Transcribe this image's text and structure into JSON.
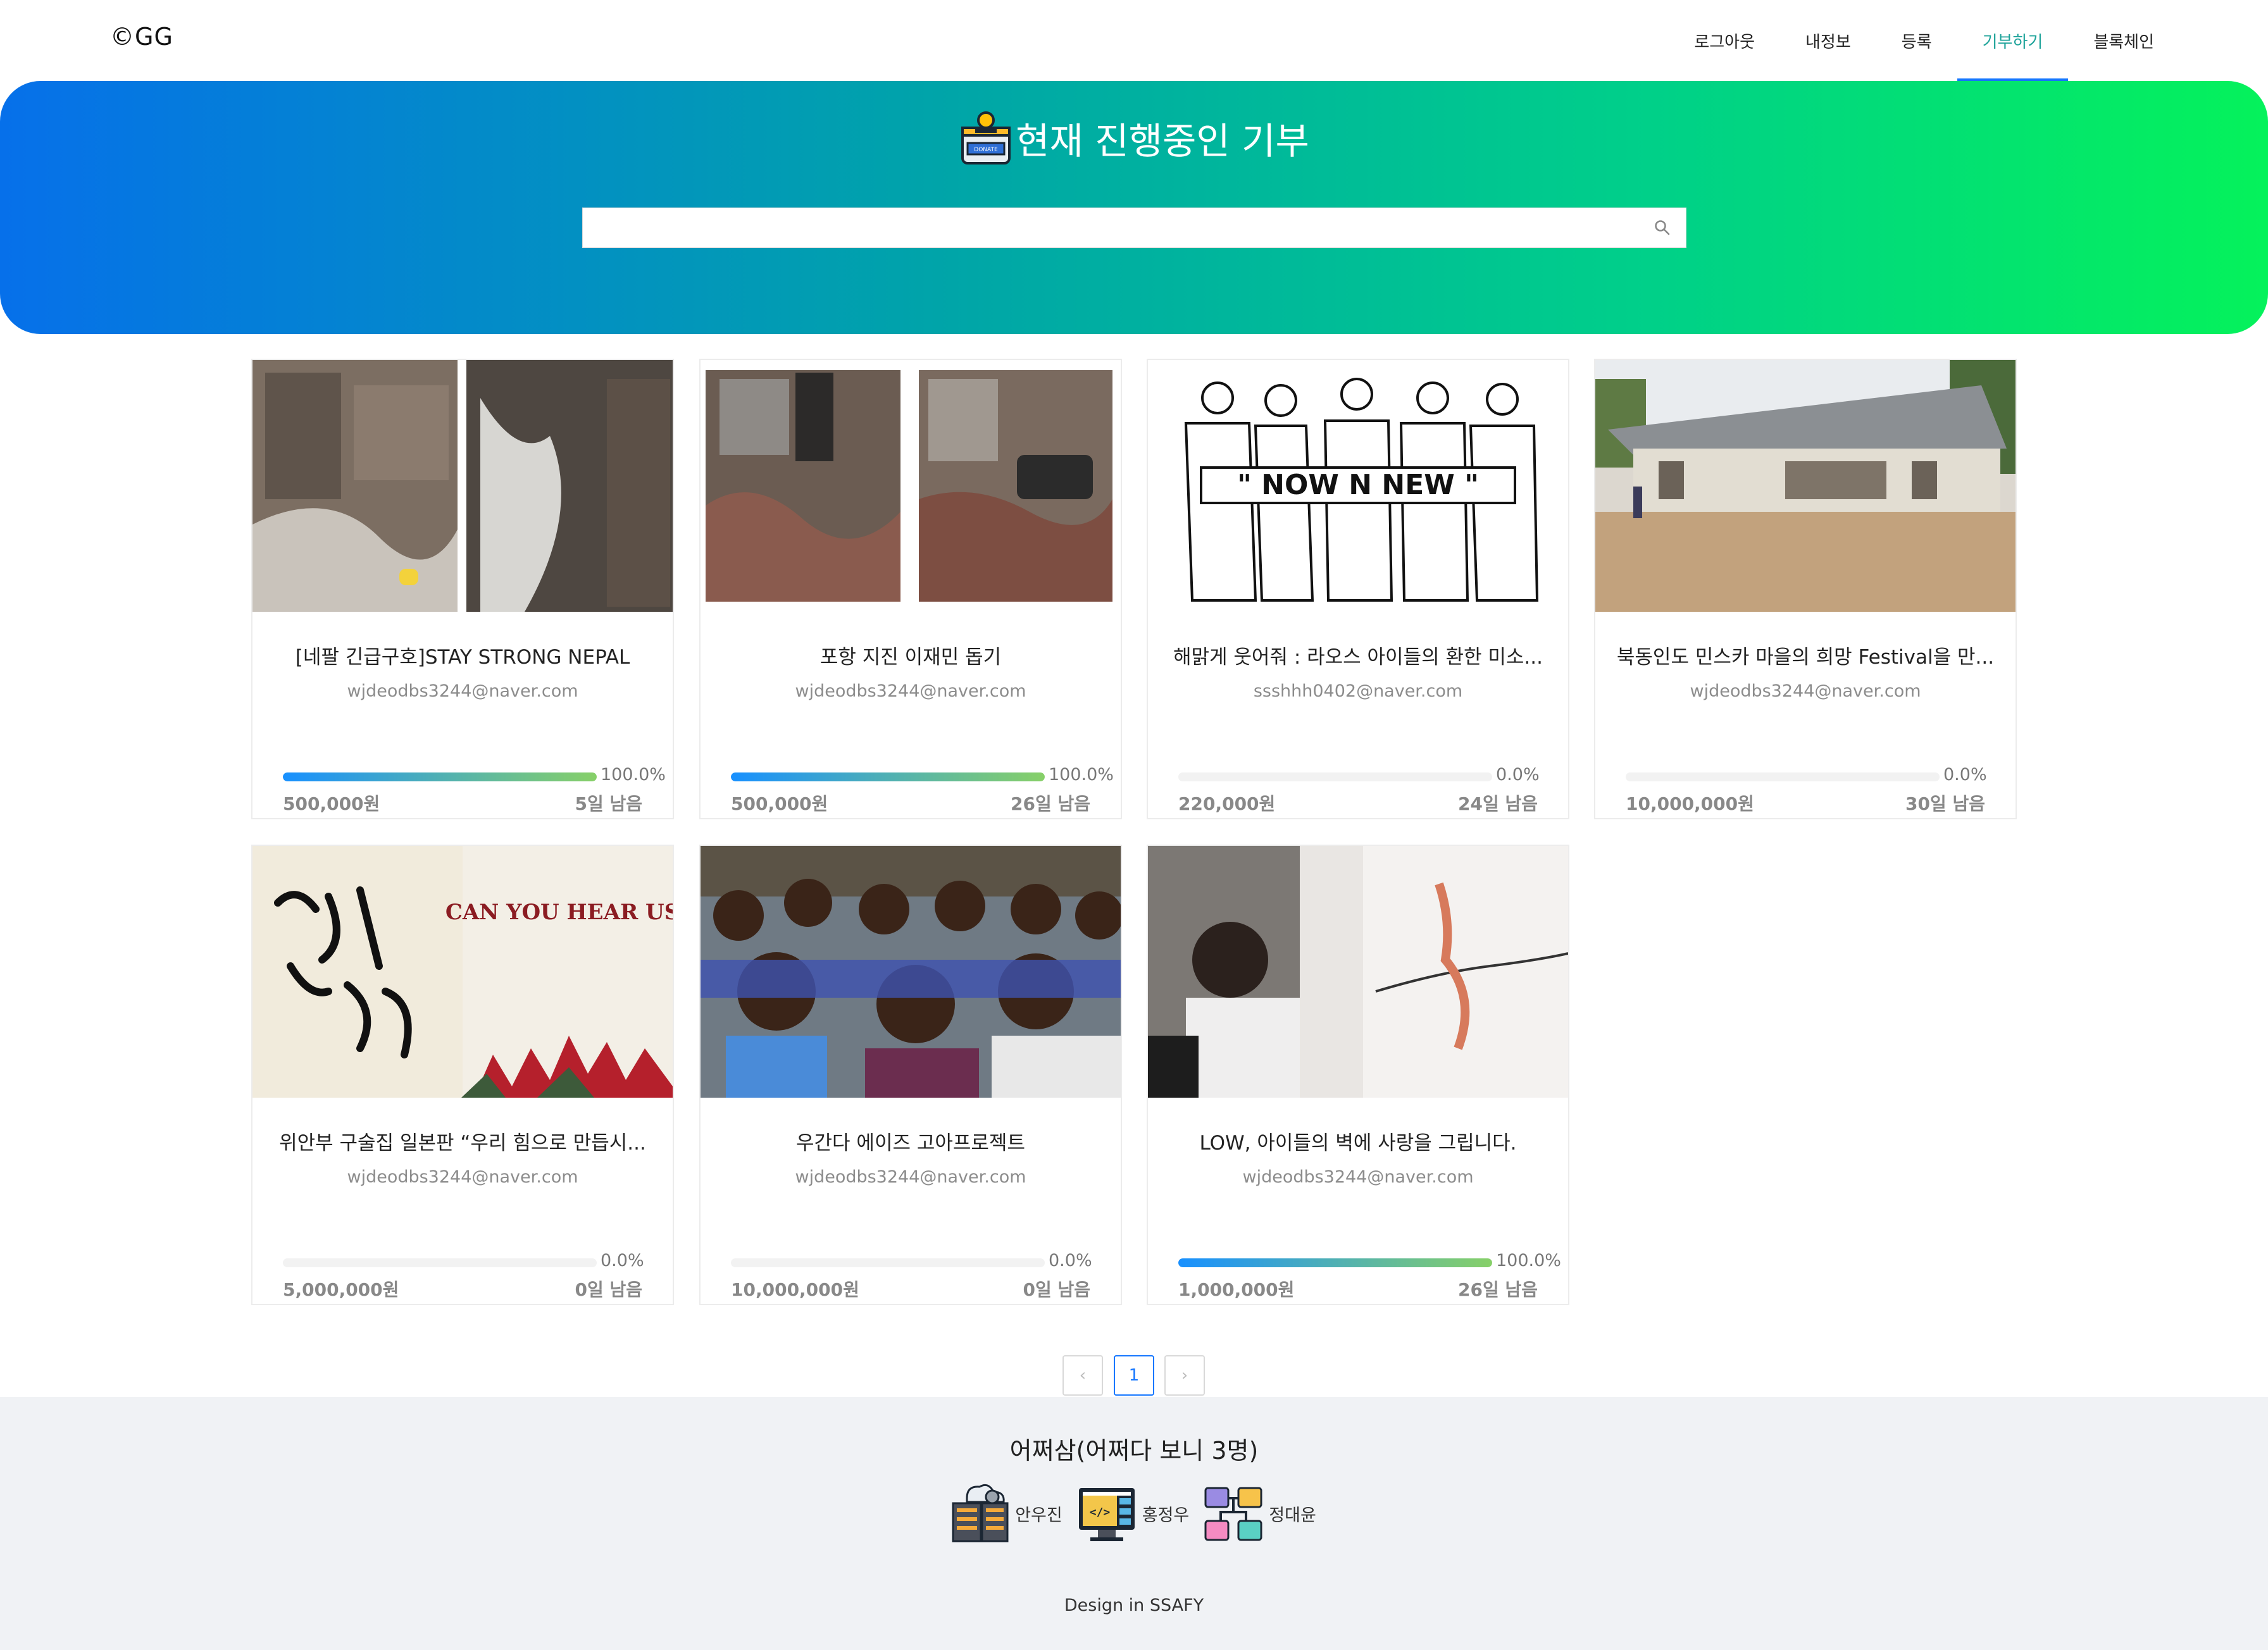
{
  "header": {
    "logo": "©GG",
    "nav": [
      "로그아웃",
      "내정보",
      "등록",
      "기부하기",
      "블록체인"
    ],
    "active_nav": "기부하기"
  },
  "hero": {
    "title": "현재 진행중인 기부",
    "icon": "donate-box-icon",
    "badge_text": "DONATE",
    "search": {
      "value": "",
      "placeholder": ""
    }
  },
  "campaigns": [
    {
      "title": "[네팔 긴급구호]STAY STRONG NEPAL",
      "author": "wjdeodbs3244@naver.com",
      "progress": "100.0%",
      "progress_value": 100,
      "amount": "500,000원",
      "days": "5일 남음"
    },
    {
      "title": "포항 지진 이재민 돕기",
      "author": "wjdeodbs3244@naver.com",
      "progress": "100.0%",
      "progress_value": 100,
      "amount": "500,000원",
      "days": "26일 남음"
    },
    {
      "title": "해맑게 웃어줘 : 라오스 아이들의 환한 미소...",
      "author": "ssshhh0402@naver.com",
      "progress": "0.0%",
      "progress_value": 0,
      "amount": "220,000원",
      "days": "24일 남음",
      "image_text": "\" NOW  N  NEW \""
    },
    {
      "title": "북동인도 민스카 마을의 희망 Festival을 만...",
      "author": "wjdeodbs3244@naver.com",
      "progress": "0.0%",
      "progress_value": 0,
      "amount": "10,000,000원",
      "days": "30일 남음"
    },
    {
      "title": "위안부 구술집 일본판 “우리 힘으로 만듭시...",
      "author": "wjdeodbs3244@naver.com",
      "progress": "0.0%",
      "progress_value": 0,
      "amount": "5,000,000원",
      "days": "0일 남음",
      "image_text": "CAN YOU HEAR US?"
    },
    {
      "title": "우간다 에이즈 고아프로젝트",
      "author": "wjdeodbs3244@naver.com",
      "progress": "0.0%",
      "progress_value": 0,
      "amount": "10,000,000원",
      "days": "0일 남음"
    },
    {
      "title": "LOW, 아이들의 벽에 사랑을 그립니다.",
      "author": "wjdeodbs3244@naver.com",
      "progress": "100.0%",
      "progress_value": 100,
      "amount": "1,000,000원",
      "days": "26일 남음"
    }
  ],
  "pagination": {
    "prev": "‹",
    "current": "1",
    "next": "›"
  },
  "footer": {
    "title": "어쩌삼(어쩌다 보니 3명)",
    "members": [
      {
        "name": "안우진",
        "icon": "server-cloud-icon"
      },
      {
        "name": "홍정우",
        "icon": "code-monitor-icon"
      },
      {
        "name": "정대윤",
        "icon": "flowchart-icon"
      }
    ],
    "credit": "Design in SSAFY"
  },
  "colors": {
    "accent": "#1677ff",
    "active_nav": "#1ea39a",
    "gradient_start": "#0670ea",
    "gradient_end": "#05f25b",
    "progress_start": "#1890ff",
    "progress_end": "#87d068"
  }
}
